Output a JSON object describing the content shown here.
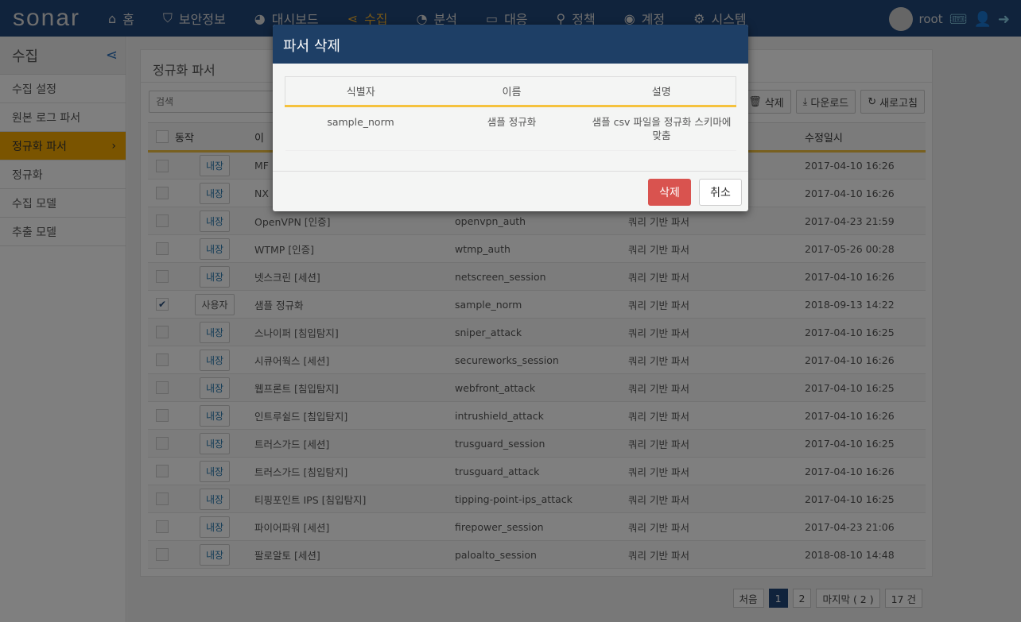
{
  "nav": {
    "logo": "sonar",
    "items": [
      {
        "icon": "home-icon",
        "glyph": "⌂",
        "label": "홈"
      },
      {
        "icon": "shield-icon",
        "glyph": "⛉",
        "label": "보안정보"
      },
      {
        "icon": "dashboard-icon",
        "glyph": "◕",
        "label": "대시보드"
      },
      {
        "icon": "share-icon",
        "glyph": "⋖",
        "label": "수집",
        "active": true
      },
      {
        "icon": "pie-chart-icon",
        "glyph": "◔",
        "label": "분석"
      },
      {
        "icon": "laptop-icon",
        "glyph": "▭",
        "label": "대응"
      },
      {
        "icon": "search-icon",
        "glyph": "⚲",
        "label": "정책"
      },
      {
        "icon": "user-circle-icon",
        "glyph": "◉",
        "label": "계정"
      },
      {
        "icon": "gear-icon",
        "glyph": "⚙",
        "label": "시스템"
      }
    ],
    "user": "root"
  },
  "sidebar": {
    "title": "수집",
    "items": [
      {
        "label": "수집 설정"
      },
      {
        "label": "원본 로그 파서"
      },
      {
        "label": "정규화 파서",
        "active": true
      },
      {
        "label": "정규화"
      },
      {
        "label": "수집 모델"
      },
      {
        "label": "추출 모델"
      }
    ]
  },
  "panel": {
    "title": "정규화 파서",
    "search_placeholder": "검색",
    "buttons": {
      "delete": "삭제",
      "download": "다운로드",
      "refresh": "새로고침"
    },
    "columns": [
      "동작",
      "이",
      "",
      "",
      "수정일시"
    ],
    "rows": [
      {
        "checked": false,
        "action": "내장",
        "name": "MF",
        "id": "",
        "type": "",
        "modified": "2017-04-10 16:26"
      },
      {
        "checked": false,
        "action": "내장",
        "name": "NX",
        "id": "",
        "type": "",
        "modified": "2017-04-10 16:26"
      },
      {
        "checked": false,
        "action": "내장",
        "name": "OpenVPN [인증]",
        "id": "openvpn_auth",
        "type": "쿼리 기반 파서",
        "modified": "2017-04-23 21:59"
      },
      {
        "checked": false,
        "action": "내장",
        "name": "WTMP [인증]",
        "id": "wtmp_auth",
        "type": "쿼리 기반 파서",
        "modified": "2017-05-26 00:28"
      },
      {
        "checked": false,
        "action": "내장",
        "name": "넷스크린 [세션]",
        "id": "netscreen_session",
        "type": "쿼리 기반 파서",
        "modified": "2017-04-10 16:26"
      },
      {
        "checked": true,
        "action": "사용자",
        "name": "샘플 정규화",
        "id": "sample_norm",
        "type": "쿼리 기반 파서",
        "modified": "2018-09-13 14:22"
      },
      {
        "checked": false,
        "action": "내장",
        "name": "스나이퍼 [침입탐지]",
        "id": "sniper_attack",
        "type": "쿼리 기반 파서",
        "modified": "2017-04-10 16:25"
      },
      {
        "checked": false,
        "action": "내장",
        "name": "시큐어웍스 [세션]",
        "id": "secureworks_session",
        "type": "쿼리 기반 파서",
        "modified": "2017-04-10 16:26"
      },
      {
        "checked": false,
        "action": "내장",
        "name": "웹프론트 [침입탐지]",
        "id": "webfront_attack",
        "type": "쿼리 기반 파서",
        "modified": "2017-04-10 16:25"
      },
      {
        "checked": false,
        "action": "내장",
        "name": "인트루쉴드 [침입탐지]",
        "id": "intrushield_attack",
        "type": "쿼리 기반 파서",
        "modified": "2017-04-10 16:26"
      },
      {
        "checked": false,
        "action": "내장",
        "name": "트러스가드 [세션]",
        "id": "trusguard_session",
        "type": "쿼리 기반 파서",
        "modified": "2017-04-10 16:25"
      },
      {
        "checked": false,
        "action": "내장",
        "name": "트러스가드 [침입탐지]",
        "id": "trusguard_attack",
        "type": "쿼리 기반 파서",
        "modified": "2017-04-10 16:26"
      },
      {
        "checked": false,
        "action": "내장",
        "name": "티핑포인트 IPS [침입탐지]",
        "id": "tipping-point-ips_attack",
        "type": "쿼리 기반 파서",
        "modified": "2017-04-10 16:25"
      },
      {
        "checked": false,
        "action": "내장",
        "name": "파이어파워 [세션]",
        "id": "firepower_session",
        "type": "쿼리 기반 파서",
        "modified": "2017-04-23 21:06"
      },
      {
        "checked": false,
        "action": "내장",
        "name": "팔로알토 [세션]",
        "id": "paloalto_session",
        "type": "쿼리 기반 파서",
        "modified": "2018-08-10 14:48"
      }
    ]
  },
  "pagination": {
    "first": "처음",
    "pages": [
      "1",
      "2"
    ],
    "current": "1",
    "last": "마지막 ( 2 )",
    "total": "17 건"
  },
  "modal": {
    "title": "파서 삭제",
    "columns": [
      "식별자",
      "이름",
      "설명"
    ],
    "row": [
      "sample_norm",
      "샘플 정규화",
      "샘플 csv 파일을 정규화 스키마에 맞춤"
    ],
    "delete": "삭제",
    "cancel": "취소"
  }
}
